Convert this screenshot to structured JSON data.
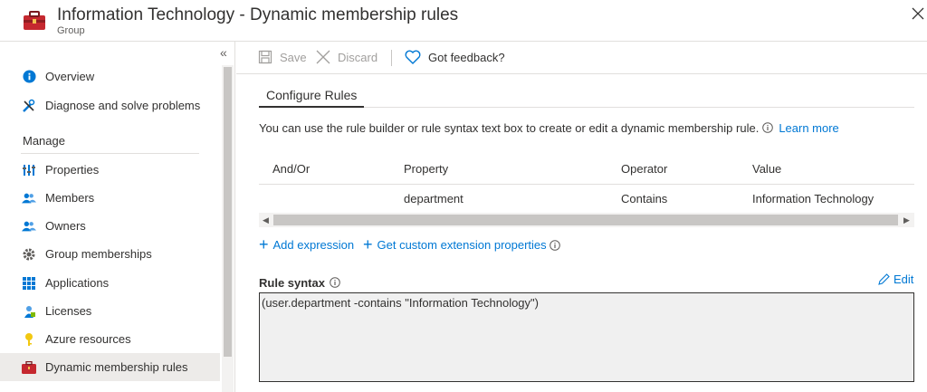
{
  "header": {
    "title": "Information Technology - Dynamic membership rules",
    "subtitle": "Group"
  },
  "sidebar": {
    "collapse_glyph": "«",
    "items": [
      {
        "label": "Overview",
        "icon": "info-icon"
      },
      {
        "label": "Diagnose and solve problems",
        "icon": "wrench-icon"
      }
    ],
    "section_label": "Manage",
    "manage_items": [
      {
        "label": "Properties",
        "icon": "properties-icon"
      },
      {
        "label": "Members",
        "icon": "members-icon"
      },
      {
        "label": "Owners",
        "icon": "owners-icon"
      },
      {
        "label": "Group memberships",
        "icon": "gear-icon"
      },
      {
        "label": "Applications",
        "icon": "grid-icon"
      },
      {
        "label": "Licenses",
        "icon": "license-icon"
      },
      {
        "label": "Azure resources",
        "icon": "key-icon"
      },
      {
        "label": "Dynamic membership rules",
        "icon": "toolbox-icon",
        "selected": true
      }
    ]
  },
  "toolbar": {
    "save_label": "Save",
    "discard_label": "Discard",
    "feedback_label": "Got feedback?"
  },
  "content": {
    "tab_label": "Configure Rules",
    "description": "You can use the rule builder or rule syntax text box to create or edit a dynamic membership rule.",
    "learn_more": "Learn more",
    "table": {
      "headers": [
        "And/Or",
        "Property",
        "Operator",
        "Value"
      ],
      "rows": [
        [
          "",
          "department",
          "Contains",
          "Information Technology"
        ]
      ]
    },
    "add_expression": "Add expression",
    "get_custom_ext": "Get custom extension properties",
    "rule_syntax_label": "Rule syntax",
    "edit_label": "Edit",
    "rule_syntax_value": "(user.department -contains \"Information Technology\")"
  },
  "colors": {
    "accent": "#0078d4",
    "selected_bg": "#edebe9",
    "rule_box_bg": "#f0f0f0"
  }
}
